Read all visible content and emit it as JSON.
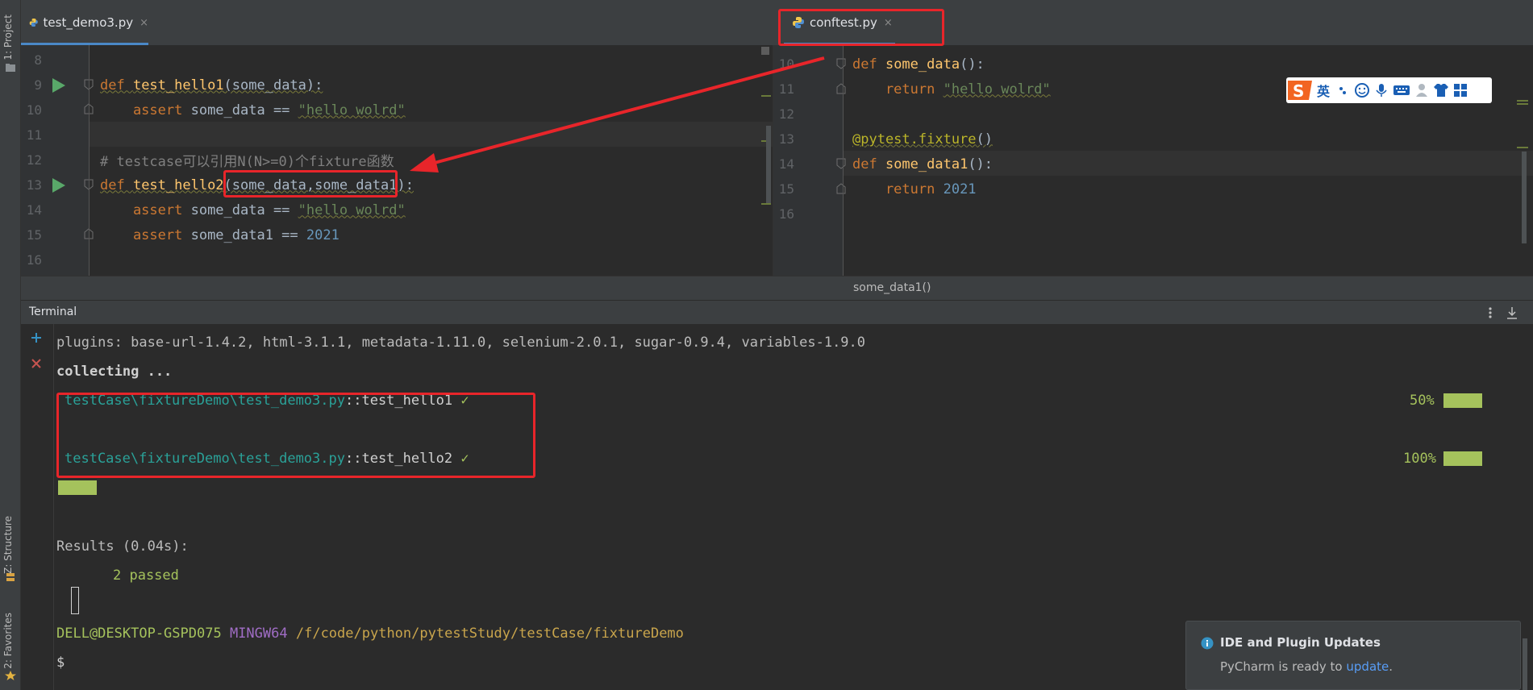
{
  "side": {
    "project_label": "1: Project",
    "structure_label": "Z: Structure",
    "favorites_label": "2: Favorites"
  },
  "left_tab": {
    "label": "test_demo3.py",
    "close": "×"
  },
  "right_tab": {
    "label": "conftest.py",
    "close": "×"
  },
  "left_editor": {
    "lines": [
      {
        "num": "8"
      },
      {
        "num": "9",
        "t1": "def ",
        "t2": "test_hello1",
        "t3": "(some_data):"
      },
      {
        "num": "10",
        "t1": "    assert ",
        "t2": "some_data == ",
        "t3": "\"hello wolrd\""
      },
      {
        "num": "11"
      },
      {
        "num": "12",
        "t1": "# testcase可以引用N(N>=0)个fixture函数"
      },
      {
        "num": "13",
        "t1": "def ",
        "t2": "test_hello2",
        "t3": "(some_data,some_data1):"
      },
      {
        "num": "14",
        "t1": "    assert ",
        "t2": "some_data == ",
        "t3": "\"hello wolrd\""
      },
      {
        "num": "15",
        "t1": "    assert ",
        "t2": "some_data1 == ",
        "t3": "2021"
      },
      {
        "num": "16"
      }
    ]
  },
  "right_editor": {
    "lines": [
      {
        "num": "10",
        "t1": "def ",
        "t2": "some_data",
        "t3": "():"
      },
      {
        "num": "11",
        "t1": "    return ",
        "t2": "\"hello wolrd\""
      },
      {
        "num": "12"
      },
      {
        "num": "13",
        "t1": "@pytest.fixture",
        "t2": "()"
      },
      {
        "num": "14",
        "t1": "def ",
        "t2": "some_data1",
        "t3": "():"
      },
      {
        "num": "15",
        "t1": "    return ",
        "t2": "2021"
      },
      {
        "num": "16"
      }
    ],
    "breadcrumb": "some_data1()"
  },
  "ime_toolbar": {
    "label": "英"
  },
  "terminal": {
    "title": "Terminal",
    "plugins_line": "plugins: base-url-1.4.2, html-3.1.1, metadata-1.11.0, selenium-2.0.1, sugar-0.9.4, variables-1.9.0",
    "collecting": "collecting ...",
    "test1_path": "testCase\\fixtureDemo\\test_demo3.py",
    "test1_name": "::test_hello1",
    "test1_pct": "50%",
    "test2_path": "testCase\\fixtureDemo\\test_demo3.py",
    "test2_name": "::test_hello2",
    "test2_pct": "100%",
    "check": "✓",
    "results": "Results (0.04s):",
    "passed": "2 passed",
    "prompt_user": "DELL@DESKTOP-GSPD075",
    "prompt_env": "MINGW64",
    "prompt_path": "/f/code/python/pytestStudy/testCase/fixtureDemo",
    "dollar": "$"
  },
  "notification": {
    "title": "IDE and Plugin Updates",
    "body": "PyCharm is ready to",
    "link": "update",
    "end": "."
  }
}
